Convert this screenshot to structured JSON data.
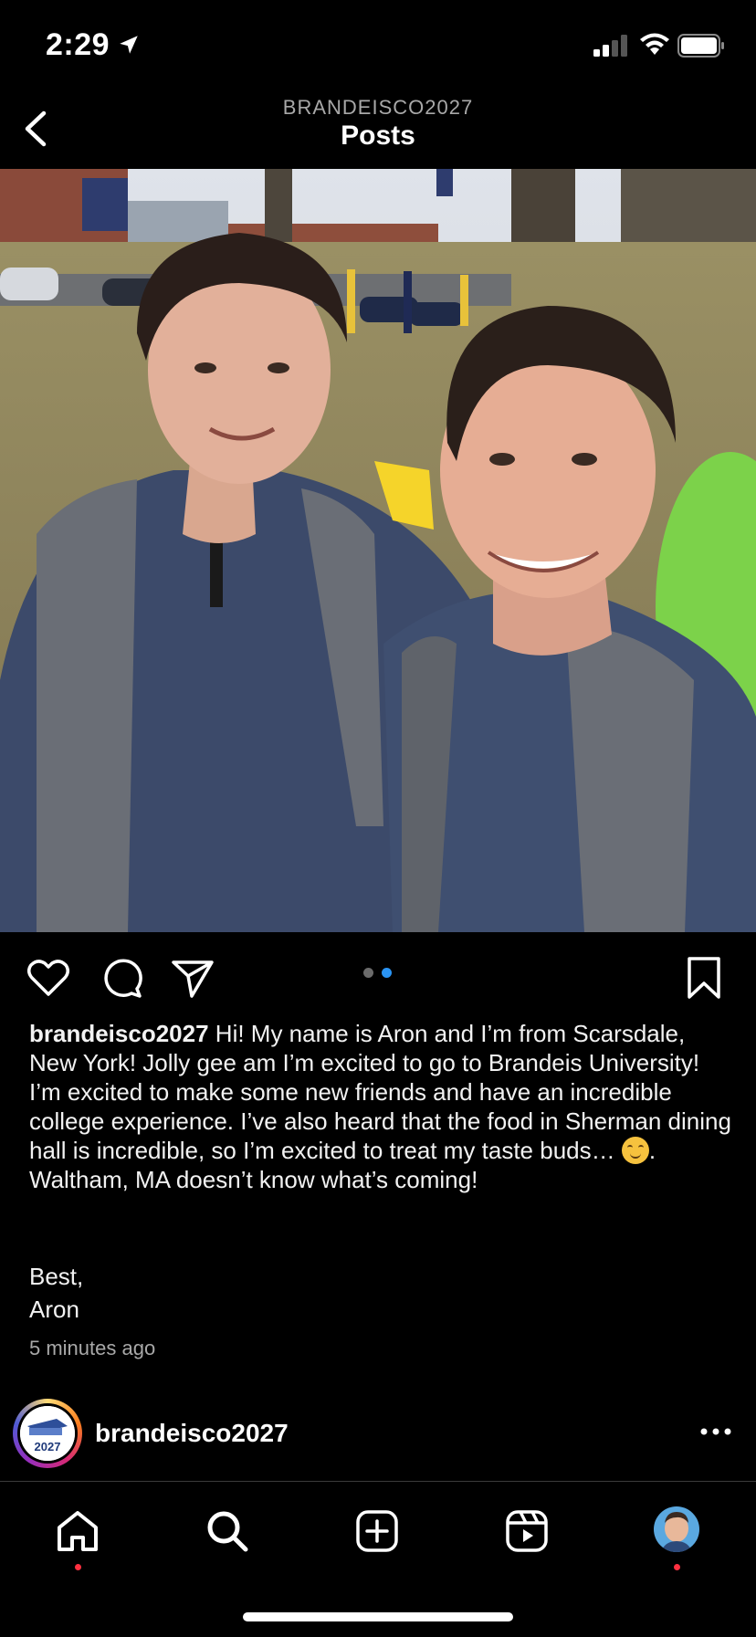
{
  "status_bar": {
    "time": "2:29",
    "icons": [
      "location-arrow-icon",
      "cellular-signal-icon",
      "wifi-icon",
      "battery-icon"
    ]
  },
  "header": {
    "account": "BRANDEISCO2027",
    "title": "Posts",
    "back_icon": "chevron-left-icon"
  },
  "post": {
    "carousel": {
      "count": 2,
      "active_index": 1
    },
    "actions": [
      "heart-icon",
      "comment-icon",
      "send-icon",
      "bookmark-icon"
    ],
    "caption_username": "brandeisco2027",
    "caption_text_1": "Hi!  My name is Aron and I’m from Scarsdale, New York!  Jolly gee am I’m excited to go to Brandeis University!  I’m excited to make some new friends and have an incredible college experience.  I’ve also heard that the food in Sherman dining hall is incredible, so I’m excited to treat my taste buds… ",
    "caption_text_2": ". Waltham, MA doesn’t know what’s coming!",
    "signoff_1": "Best,",
    "signoff_2": "Aron",
    "timestamp": "5 minutes ago"
  },
  "next_post": {
    "username": "brandeisco2027",
    "avatar_text": "2027",
    "more_icon": "more-horizontal-icon"
  },
  "tab_bar": {
    "items": [
      "home-icon",
      "search-icon",
      "create-icon",
      "reels-icon",
      "profile-avatar"
    ]
  },
  "colors": {
    "background": "#000000",
    "accent_blue": "#2a94f4",
    "notification_red": "#ff3040",
    "secondary_text": "#a8a8a8"
  }
}
